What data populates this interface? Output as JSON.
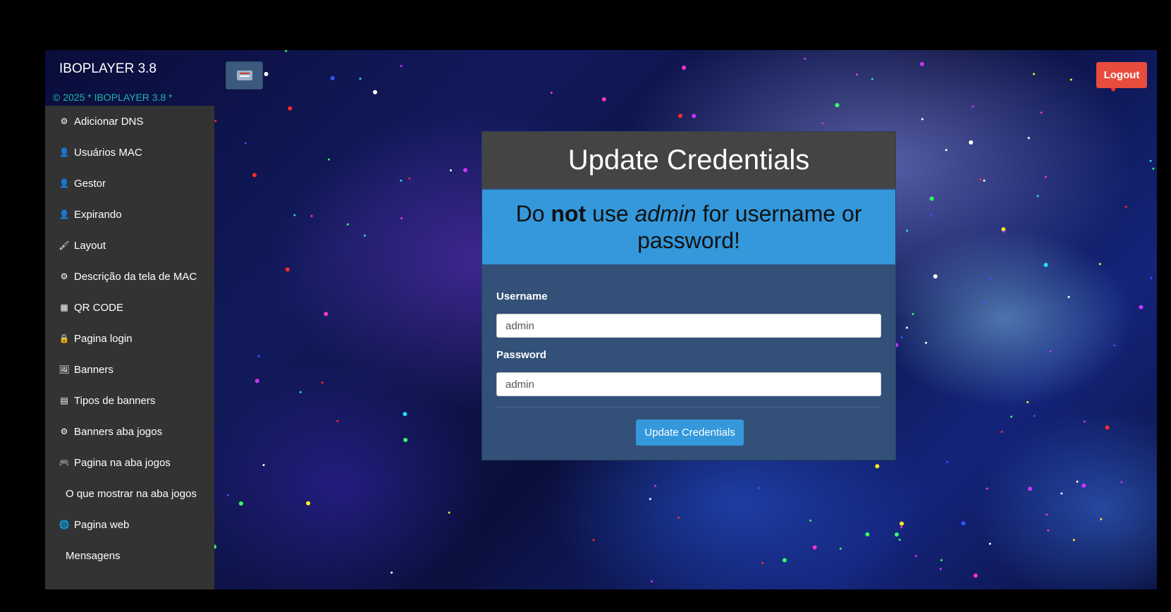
{
  "app": {
    "brand": "IBOPLAYER 3.8",
    "copyright": "© 2025 * IBOPLAYER 3.8 *"
  },
  "sidebar": {
    "items": [
      {
        "label": "Adicionar DNS",
        "icon": "cogs-icon",
        "glyph": "⚙"
      },
      {
        "label": "Usuários MAC",
        "icon": "user-icon",
        "glyph": "👤"
      },
      {
        "label": "Gestor",
        "icon": "user-icon",
        "glyph": "👤"
      },
      {
        "label": "Expirando",
        "icon": "user-icon",
        "glyph": "👤"
      },
      {
        "label": "Layout",
        "icon": "brush-icon",
        "glyph": "🖌"
      },
      {
        "label": "Descrição da tela de MAC",
        "icon": "gear-icon",
        "glyph": "⚙"
      },
      {
        "label": "QR CODE",
        "icon": "qrcode-icon",
        "glyph": "▦"
      },
      {
        "label": "Pagina login",
        "icon": "lock-icon",
        "glyph": "🔒"
      },
      {
        "label": "Banners",
        "icon": "image-icon",
        "glyph": "🖼"
      },
      {
        "label": "Tipos de banners",
        "icon": "banner-icon",
        "glyph": "▤"
      },
      {
        "label": "Banners aba jogos",
        "icon": "cogs-icon",
        "glyph": "⚙"
      },
      {
        "label": "Pagina na aba jogos",
        "icon": "gamepad-icon",
        "glyph": "🎮"
      },
      {
        "label": "O que mostrar na aba jogos",
        "icon": "",
        "glyph": ""
      },
      {
        "label": "Pagina web",
        "icon": "globe-icon",
        "glyph": "🌐"
      },
      {
        "label": "Mensagens",
        "icon": "",
        "glyph": ""
      }
    ]
  },
  "topbar": {
    "logout_label": "Logout"
  },
  "card": {
    "title": "Update Credentials",
    "warning_prefix": "Do ",
    "warning_bold": "not",
    "warning_mid": " use ",
    "warning_italic": "admin",
    "warning_suffix": " for username or password!",
    "username_label": "Username",
    "username_value": "admin",
    "password_label": "Password",
    "password_value": "admin",
    "submit_label": "Update Credentials"
  },
  "colors": {
    "sidebar_bg": "#333333",
    "accent": "#3498db",
    "logout": "#e74c3c",
    "card_bg": "#325078",
    "copyright": "#1fb6a6"
  }
}
